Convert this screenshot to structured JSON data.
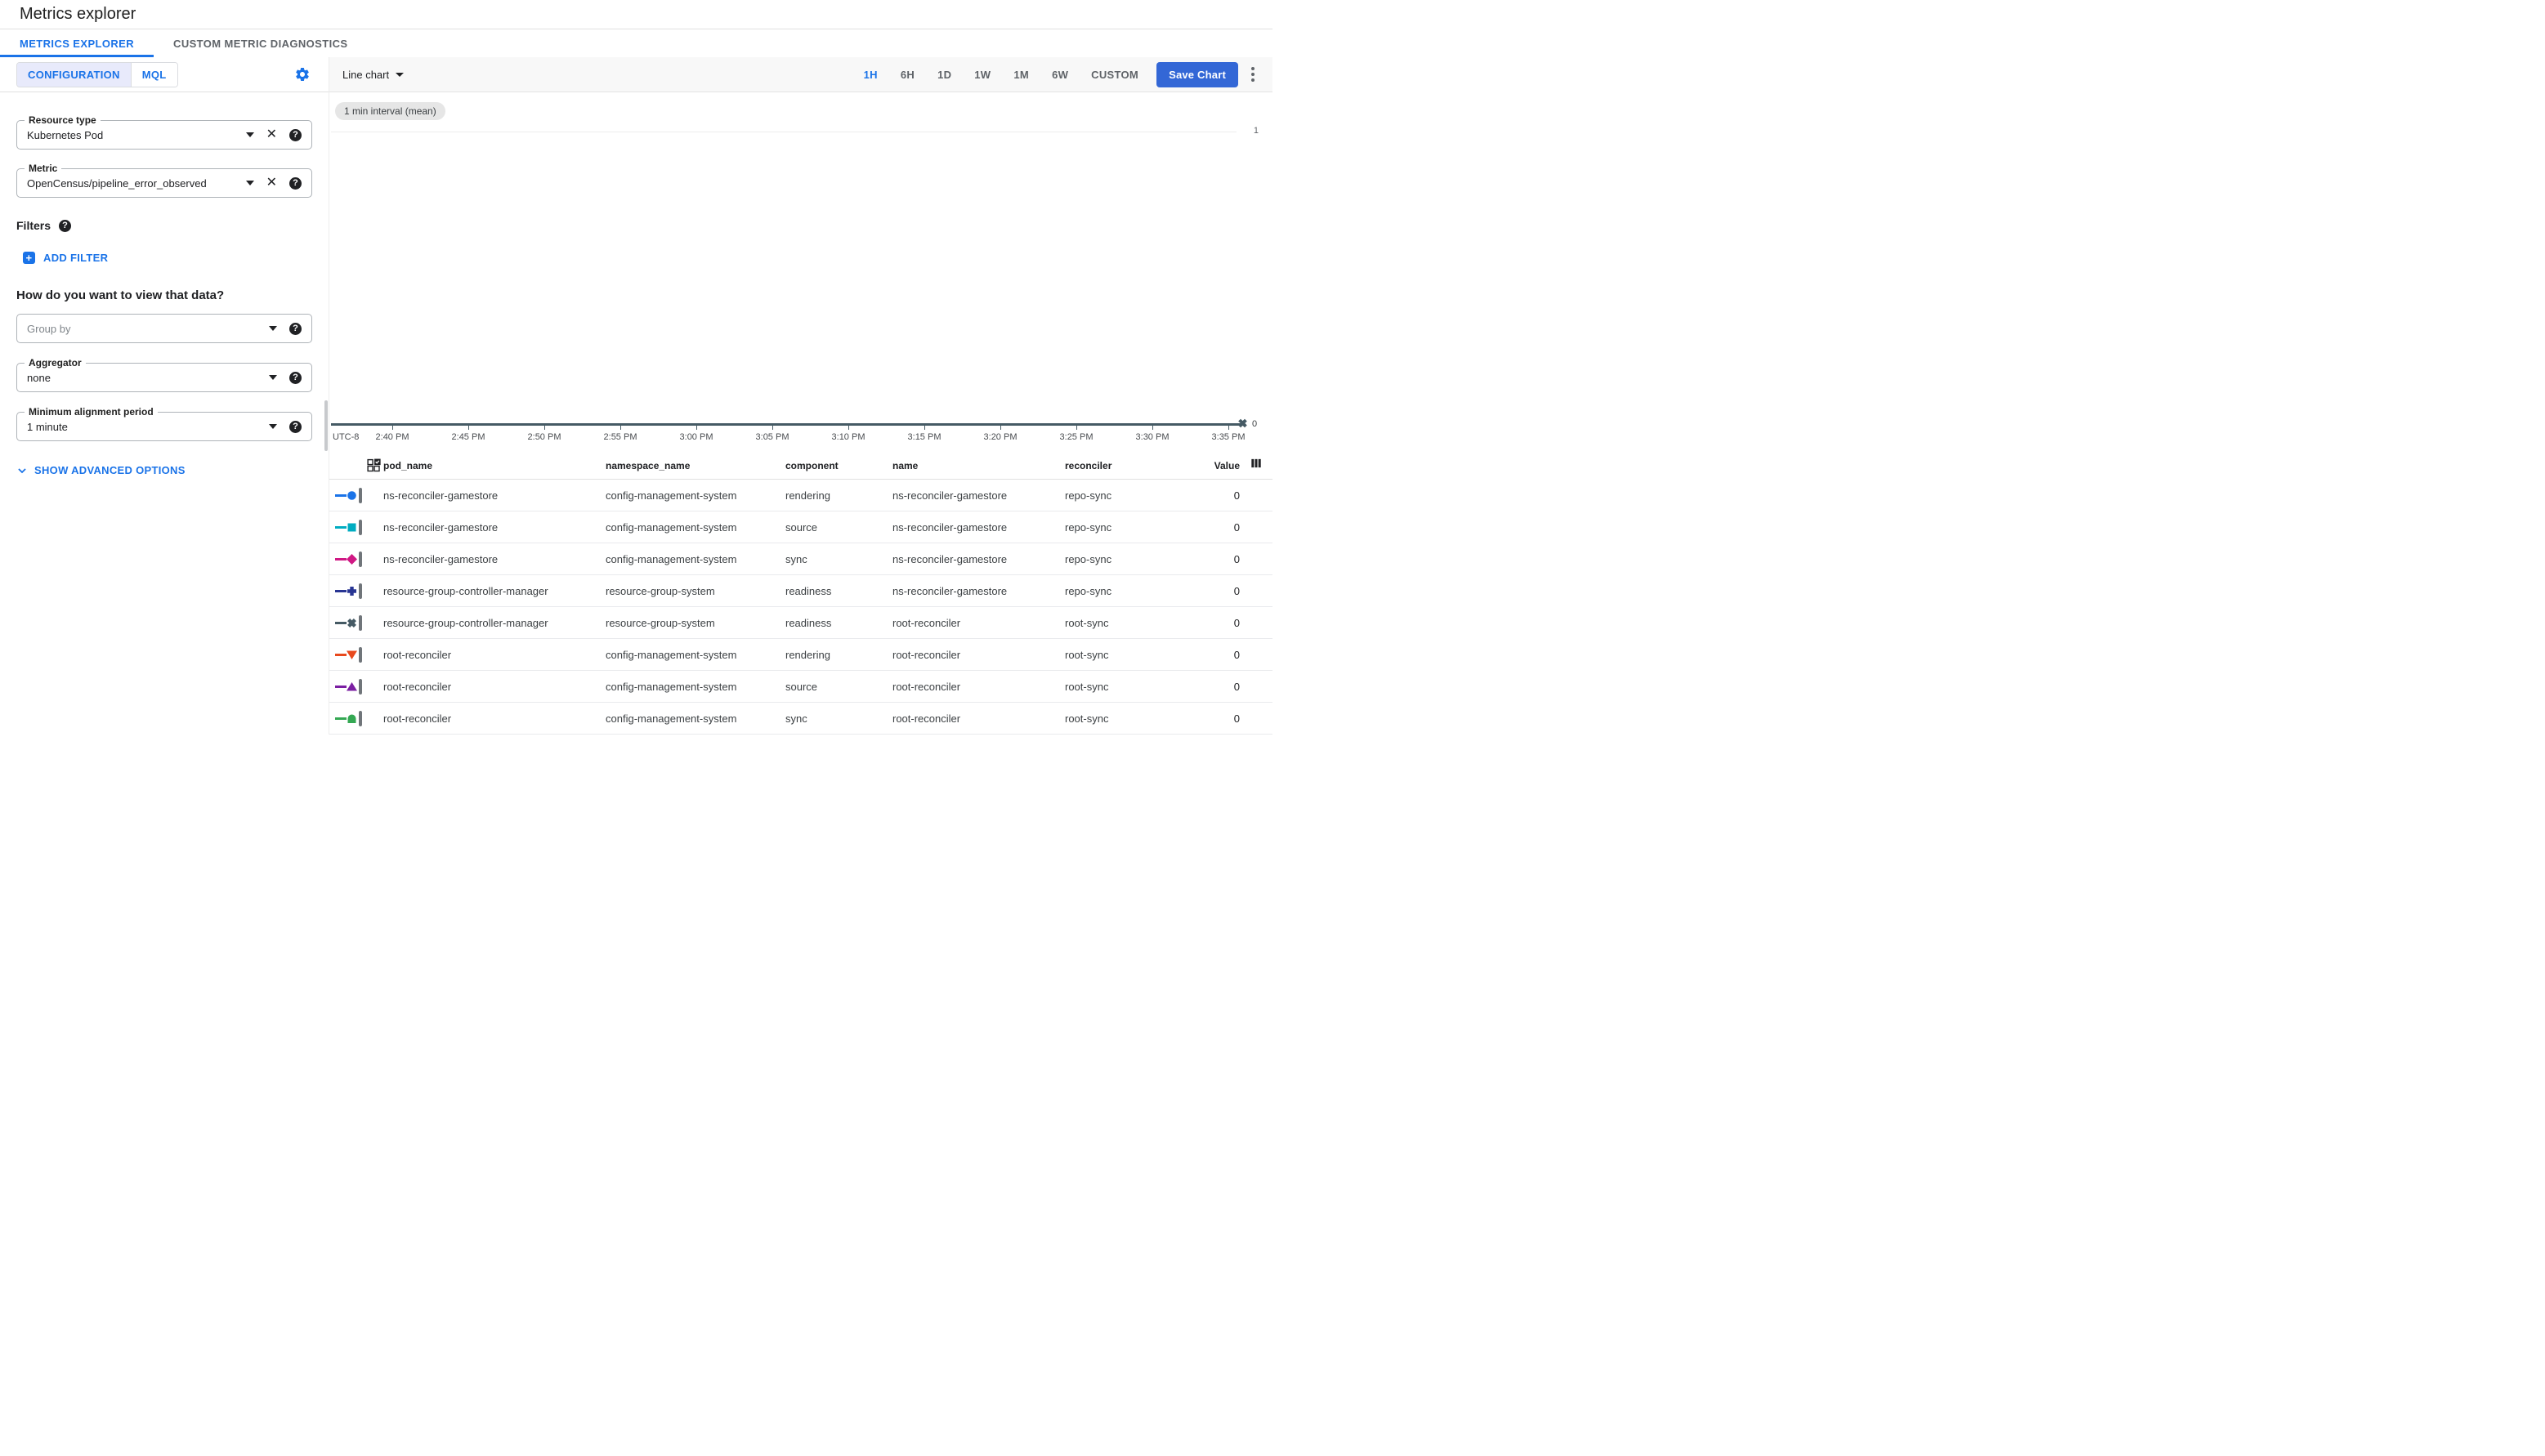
{
  "header": {
    "title": "Metrics explorer"
  },
  "tabs": {
    "metrics_explorer": "METRICS EXPLORER",
    "custom_metric_diagnostics": "CUSTOM METRIC DIAGNOSTICS"
  },
  "panel": {
    "configuration_label": "CONFIGURATION",
    "mql_label": "MQL",
    "resource_type": {
      "label": "Resource type",
      "value": "Kubernetes Pod"
    },
    "metric": {
      "label": "Metric",
      "value": "OpenCensus/pipeline_error_observed"
    },
    "filters_label": "Filters",
    "add_filter_label": "ADD FILTER",
    "view_heading": "How do you want to view that data?",
    "group_by": {
      "placeholder": "Group by"
    },
    "aggregator": {
      "label": "Aggregator",
      "value": "none"
    },
    "min_alignment_period": {
      "label": "Minimum alignment period",
      "value": "1 minute"
    },
    "show_advanced_label": "SHOW ADVANCED OPTIONS"
  },
  "toolbar": {
    "chart_type_label": "Line chart",
    "ranges": [
      "1H",
      "6H",
      "1D",
      "1W",
      "1M",
      "6W",
      "CUSTOM"
    ],
    "active_range": "1H",
    "save_label": "Save Chart"
  },
  "chart": {
    "interval_chip": "1 min interval (mean)",
    "utc_label": "UTC-8",
    "x_ticks": [
      "2:40 PM",
      "2:45 PM",
      "2:50 PM",
      "2:55 PM",
      "3:00 PM",
      "3:05 PM",
      "3:10 PM",
      "3:15 PM",
      "3:20 PM",
      "3:25 PM",
      "3:30 PM",
      "3:35 PM"
    ],
    "y_gridline_label": "1",
    "end_point_label": "0"
  },
  "chart_data": {
    "type": "line",
    "title": "",
    "xlabel": "Time (UTC-8)",
    "ylabel": "",
    "ylim": [
      0,
      1
    ],
    "x_range": [
      "2:40 PM",
      "3:35 PM"
    ],
    "x": [
      "3:35 PM"
    ],
    "series": [
      {
        "name": "ns-reconciler-gamestore / rendering",
        "color": "#1a73e8",
        "values": [
          0
        ]
      },
      {
        "name": "ns-reconciler-gamestore / source",
        "color": "#00acc1",
        "values": [
          0
        ]
      },
      {
        "name": "ns-reconciler-gamestore / sync",
        "color": "#d01884",
        "values": [
          0
        ]
      },
      {
        "name": "resource-group-controller-manager / readiness (ns-reconciler-gamestore)",
        "color": "#283593",
        "values": [
          0
        ]
      },
      {
        "name": "resource-group-controller-manager / readiness (root-reconciler)",
        "color": "#455a64",
        "values": [
          0
        ]
      },
      {
        "name": "root-reconciler / rendering",
        "color": "#e8491d",
        "values": [
          0
        ]
      },
      {
        "name": "root-reconciler / source",
        "color": "#7b1fa2",
        "values": [
          0
        ]
      },
      {
        "name": "root-reconciler / sync",
        "color": "#34a853",
        "values": [
          0
        ]
      }
    ],
    "legend_position": "table-below",
    "grid": "horizontal-only"
  },
  "table": {
    "columns": [
      "pod_name",
      "namespace_name",
      "component",
      "name",
      "reconciler",
      "Value"
    ],
    "rows": [
      {
        "marker_style": "color:#1a73e8",
        "shape": "circle",
        "pod_name": "ns-reconciler-gamestore",
        "namespace_name": "config-management-system",
        "component": "rendering",
        "name": "ns-reconciler-gamestore",
        "reconciler": "repo-sync",
        "value": "0"
      },
      {
        "marker_style": "color:#00acc1",
        "shape": "square",
        "pod_name": "ns-reconciler-gamestore",
        "namespace_name": "config-management-system",
        "component": "source",
        "name": "ns-reconciler-gamestore",
        "reconciler": "repo-sync",
        "value": "0"
      },
      {
        "marker_style": "color:#d01884",
        "shape": "diamond",
        "pod_name": "ns-reconciler-gamestore",
        "namespace_name": "config-management-system",
        "component": "sync",
        "name": "ns-reconciler-gamestore",
        "reconciler": "repo-sync",
        "value": "0"
      },
      {
        "marker_style": "color:#283593",
        "shape": "plus",
        "pod_name": "resource-group-controller-manager",
        "namespace_name": "resource-group-system",
        "component": "readiness",
        "name": "ns-reconciler-gamestore",
        "reconciler": "repo-sync",
        "value": "0"
      },
      {
        "marker_style": "color:#455a64",
        "shape": "cross-x",
        "pod_name": "resource-group-controller-manager",
        "namespace_name": "resource-group-system",
        "component": "readiness",
        "name": "root-reconciler",
        "reconciler": "root-sync",
        "value": "0"
      },
      {
        "marker_style": "color:#e8491d",
        "shape": "triangle-down",
        "pod_name": "root-reconciler",
        "namespace_name": "config-management-system",
        "component": "rendering",
        "name": "root-reconciler",
        "reconciler": "root-sync",
        "value": "0"
      },
      {
        "marker_style": "color:#7b1fa2",
        "shape": "triangle-up",
        "pod_name": "root-reconciler",
        "namespace_name": "config-management-system",
        "component": "source",
        "name": "root-reconciler",
        "reconciler": "root-sync",
        "value": "0"
      },
      {
        "marker_style": "color:#34a853",
        "shape": "arch",
        "pod_name": "root-reconciler",
        "namespace_name": "config-management-system",
        "component": "sync",
        "name": "root-reconciler",
        "reconciler": "root-sync",
        "value": "0"
      }
    ]
  }
}
